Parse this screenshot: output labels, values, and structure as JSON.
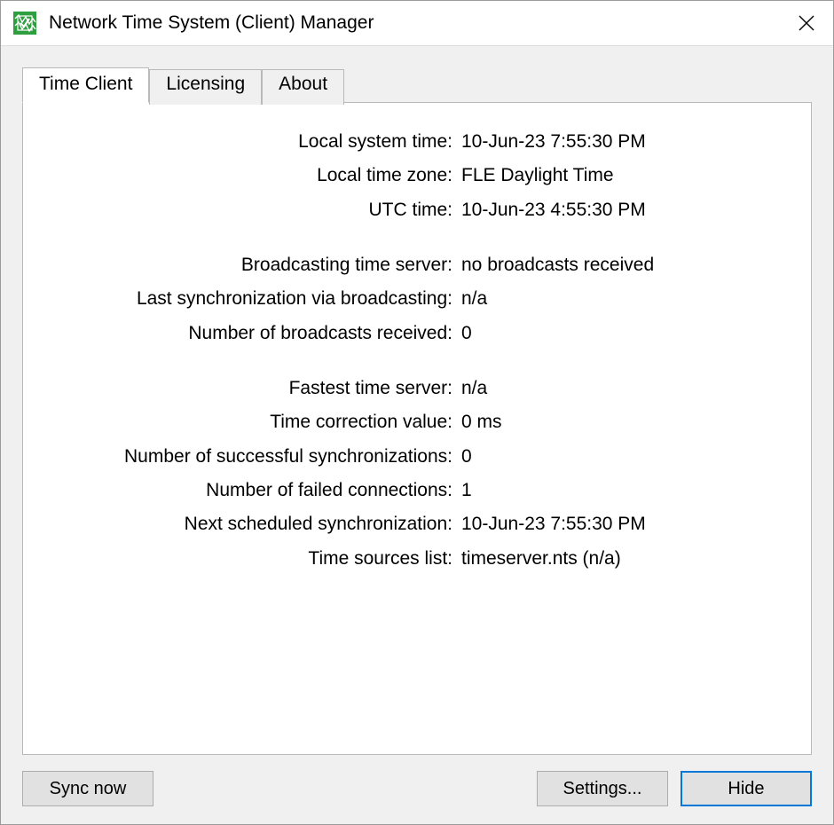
{
  "window": {
    "title": "Network Time System (Client) Manager"
  },
  "tabs": [
    {
      "label": "Time Client",
      "active": true
    },
    {
      "label": "Licensing",
      "active": false
    },
    {
      "label": "About",
      "active": false
    }
  ],
  "fields": {
    "local_system_time": {
      "label": "Local system time:",
      "value": "10-Jun-23 7:55:30 PM"
    },
    "local_time_zone": {
      "label": "Local time zone:",
      "value": "FLE Daylight Time"
    },
    "utc_time": {
      "label": "UTC time:",
      "value": "10-Jun-23 4:55:30 PM"
    },
    "broadcast_server": {
      "label": "Broadcasting time server:",
      "value": "no broadcasts received"
    },
    "last_sync_bcast": {
      "label": "Last synchronization via broadcasting:",
      "value": "n/a"
    },
    "num_bcast": {
      "label": "Number of broadcasts received:",
      "value": "0"
    },
    "fastest_server": {
      "label": "Fastest time server:",
      "value": "n/a"
    },
    "correction": {
      "label": "Time correction value:",
      "value": "0 ms"
    },
    "num_sync_ok": {
      "label": "Number of successful synchronizations:",
      "value": "0"
    },
    "num_failed": {
      "label": "Number of failed connections:",
      "value": "1"
    },
    "next_sync": {
      "label": "Next scheduled synchronization:",
      "value": "10-Jun-23 7:55:30 PM"
    },
    "sources": {
      "label": "Time sources list:",
      "value": "timeserver.nts (n/a)"
    }
  },
  "buttons": {
    "sync_now": "Sync now",
    "settings": "Settings...",
    "hide": "Hide"
  }
}
